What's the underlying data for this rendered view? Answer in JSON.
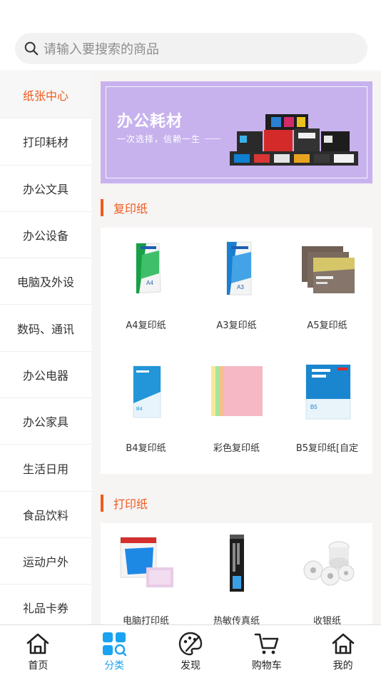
{
  "search": {
    "placeholder": "请输入要搜索的商品"
  },
  "sidebar": {
    "items": [
      {
        "label": "纸张中心",
        "active": true
      },
      {
        "label": "打印耗材"
      },
      {
        "label": "办公文具"
      },
      {
        "label": "办公设备"
      },
      {
        "label": "电脑及外设"
      },
      {
        "label": "数码、通讯"
      },
      {
        "label": "办公电器"
      },
      {
        "label": "办公家具"
      },
      {
        "label": "生活日用"
      },
      {
        "label": "食品饮料"
      },
      {
        "label": "运动户外"
      },
      {
        "label": "礼品卡券"
      }
    ]
  },
  "banner": {
    "title": "办公耗材",
    "subtitle": "一次选择，信赖一生"
  },
  "sections": [
    {
      "title": "复印纸",
      "products": [
        {
          "label": "A4复印纸"
        },
        {
          "label": "A3复印纸"
        },
        {
          "label": "A5复印纸"
        },
        {
          "label": "B4复印纸"
        },
        {
          "label": "彩色复印纸"
        },
        {
          "label": "B5复印纸[自定"
        }
      ]
    },
    {
      "title": "打印纸",
      "products": [
        {
          "label": "电脑打印纸"
        },
        {
          "label": "热敏传真纸"
        },
        {
          "label": "收银纸"
        }
      ]
    }
  ],
  "tabbar": {
    "tabs": [
      {
        "label": "首页"
      },
      {
        "label": "分类",
        "active": true
      },
      {
        "label": "发现"
      },
      {
        "label": "购物车"
      },
      {
        "label": "我的"
      }
    ]
  },
  "colors": {
    "accent": "#f05a1a",
    "tab_active": "#1aa3f0",
    "banner_bg": "#c7b2ee"
  }
}
